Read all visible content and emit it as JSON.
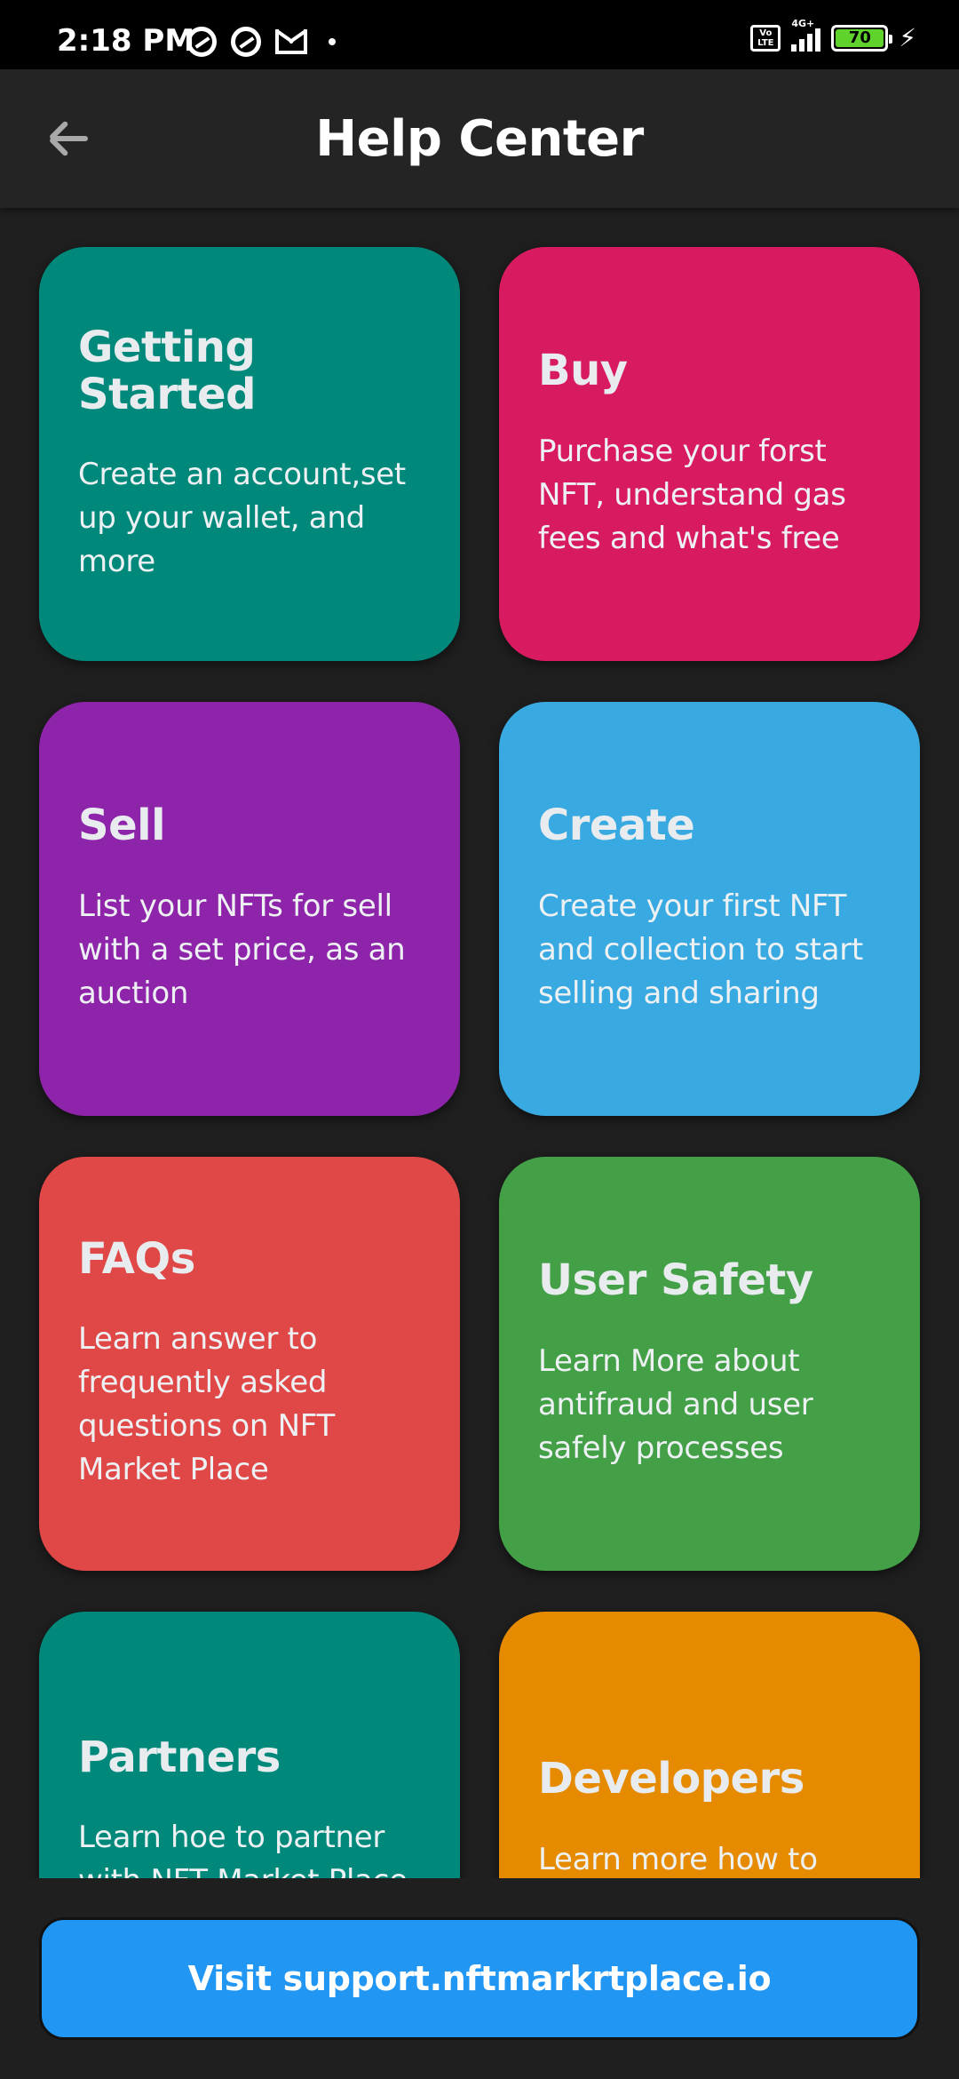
{
  "status_bar": {
    "time": "2:18 PM",
    "left_icons": [
      "target-icon",
      "target-icon",
      "gmail-icon",
      "dot-icon"
    ],
    "volte": "Vo LTE",
    "network": "4G+",
    "battery": "70",
    "battery_color": "#5fd32c"
  },
  "app_bar": {
    "back_icon": "back-arrow-icon",
    "title": "Help Center"
  },
  "cards": [
    {
      "title": "Getting Started",
      "description": "Create an account,set up your wallet, and more",
      "color": "#00897b"
    },
    {
      "title": "Buy",
      "description": "Purchase your forst NFT, understand gas fees and what's free",
      "color": "#d81b60"
    },
    {
      "title": "Sell",
      "description": "List your NFTs for sell with a set price, as an auction",
      "color": "#8e24aa"
    },
    {
      "title": "Create",
      "description": "Create your first NFT and collection to start selling and sharing",
      "color": "#39aae1"
    },
    {
      "title": "FAQs",
      "description": "Learn answer to frequently asked questions on NFT Market Place",
      "color": "#e04848"
    },
    {
      "title": "User Safety",
      "description": "Learn More about antifraud and user safely processes",
      "color": "#43a047"
    },
    {
      "title": "Partners",
      "description": "Learn hoe to partner with NFT Market Place",
      "color": "#00897b"
    },
    {
      "title": "Developers",
      "description": "Learn more how to",
      "color": "#e68a00"
    }
  ],
  "visit_button": {
    "label": "Visit support.nftmarkrtplace.io",
    "color": "#2196f3"
  }
}
